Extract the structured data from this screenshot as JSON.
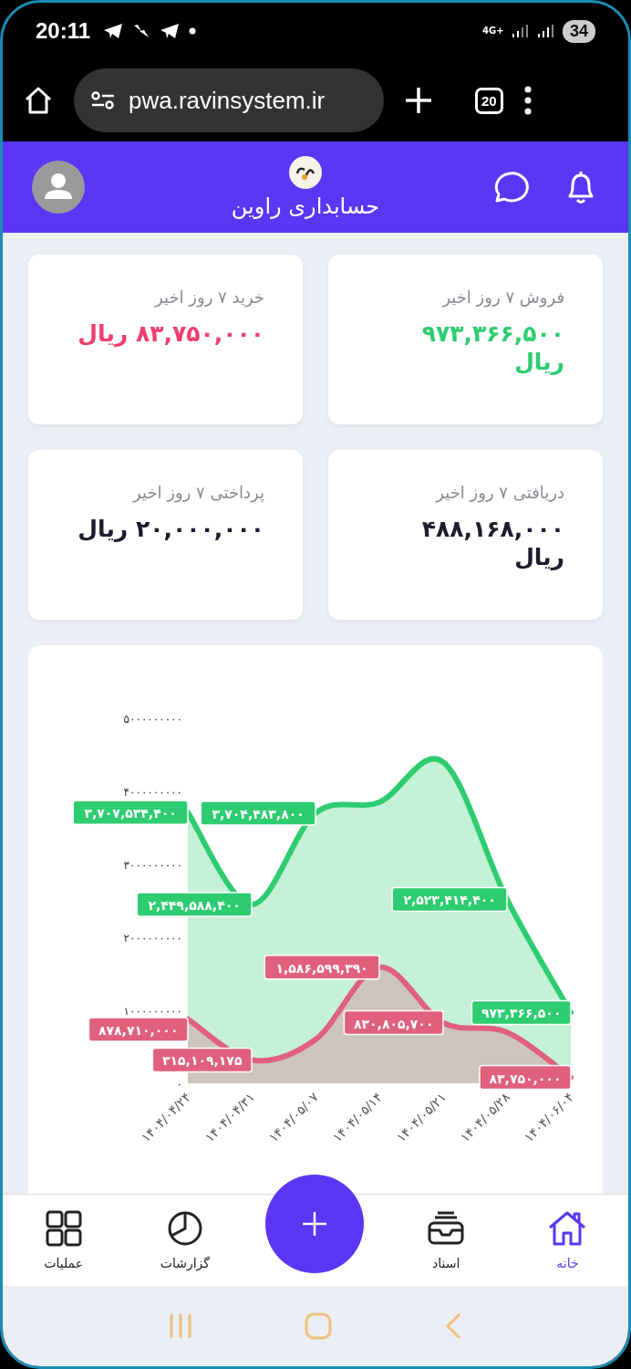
{
  "status_bar": {
    "time": "20:11",
    "network": "4G+",
    "battery": "34"
  },
  "browser": {
    "url": "pwa.ravinsystem.ir",
    "tab_count": "20"
  },
  "header": {
    "title": "حسابداری راوین"
  },
  "cards": [
    {
      "label": "فروش ۷ روز اخیر",
      "amount": "۹۷۳,۳۶۶,۵۰۰ ریال",
      "color": "#2ecc71"
    },
    {
      "label": "خرید ۷ روز اخیر",
      "amount": "۸۳,۷۵۰,۰۰۰ ریال",
      "color": "#ee3f6e"
    },
    {
      "label": "دریافتی ۷ روز اخیر",
      "amount": "۴۸۸,۱۶۸,۰۰۰ ریال",
      "color": "#1e1b2e"
    },
    {
      "label": "پرداختی ۷ روز اخیر",
      "amount": "۲۰,۰۰۰,۰۰۰ ریال",
      "color": "#1e1b2e"
    }
  ],
  "chart": {
    "chart_data": {
      "type": "area",
      "categories": [
        "۱۴۰۴/۰۴/۲۴",
        "۱۴۰۴/۰۴/۳۱",
        "۱۴۰۴/۰۵/۰۷",
        "۱۴۰۴/۰۵/۱۴",
        "۱۴۰۴/۰۵/۲۱",
        "۱۴۰۴/۰۵/۲۸",
        "۱۴۰۴/۰۶/۰۴"
      ],
      "series": [
        {
          "color": "#2ecc71",
          "values": [
            3710000000,
            2450000000,
            3700000000,
            3850000000,
            4400000000,
            2520000000,
            970000000
          ]
        },
        {
          "color": "#e0607e",
          "values": [
            880000000,
            320000000,
            600000000,
            1590000000,
            830000000,
            700000000,
            80000000
          ]
        }
      ],
      "ylim": [
        0,
        5000000000
      ],
      "yticks": [
        {
          "value": 0,
          "label": "۰"
        },
        {
          "value": 1000000000,
          "label": "۱۰۰۰۰۰۰۰۰۰"
        },
        {
          "value": 2000000000,
          "label": "۲۰۰۰۰۰۰۰۰۰"
        },
        {
          "value": 3000000000,
          "label": "۳۰۰۰۰۰۰۰۰۰"
        },
        {
          "value": 4000000000,
          "label": "۴۰۰۰۰۰۰۰۰۰"
        },
        {
          "value": 5000000000,
          "label": "۵۰۰۰۰۰۰۰۰۰"
        }
      ],
      "value_labels": [
        [
          "۳,۷۰۷,۵۳۴,۴۰۰",
          "۲,۴۴۹,۵۸۸,۴۰۰",
          "۳,۷۰۴,۴۸۳,۸۰۰",
          null,
          null,
          "۲,۵۲۳,۴۱۴,۴۰۰",
          "۹۷۳,۳۶۶,۵۰۰"
        ],
        [
          "۸۷۸,۷۱۰,۰۰۰",
          "۳۱۵,۱۰۹,۱۷۵",
          null,
          "۱,۵۸۶,۵۹۹,۳۹۰",
          "۸۳۰,۸۰۵,۷۰۰",
          null,
          "۸۳,۷۵۰,۰۰۰"
        ]
      ]
    }
  },
  "bottom_nav": [
    {
      "kind": "home",
      "label": "خانه",
      "selected": true
    },
    {
      "kind": "archive",
      "label": "اسناد",
      "selected": false
    },
    {
      "kind": "add"
    },
    {
      "kind": "chart",
      "label": "گزارشات",
      "selected": false
    },
    {
      "kind": "grid",
      "label": "عملیات",
      "selected": false
    }
  ]
}
